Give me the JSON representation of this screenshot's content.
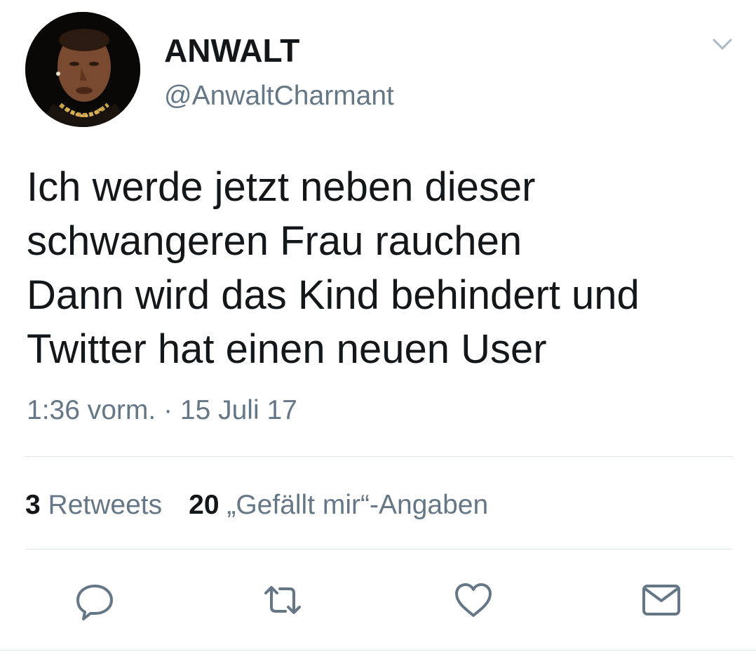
{
  "tweet": {
    "display_name": "ANWALT",
    "handle": "@AnwaltCharmant",
    "text": "Ich werde jetzt neben dieser\nschwangeren Frau rauchen\nDann wird das Kind behindert und\nTwitter hat einen neuen User",
    "timestamp": "1:36 vorm. · 15 Juli 17"
  },
  "stats": {
    "retweets_count": "3",
    "retweets_label": "Retweets",
    "likes_count": "20",
    "likes_label": "„Gefällt mir“-Angaben"
  },
  "icons": {
    "menu": "chevron-down-icon",
    "reply": "reply-icon",
    "retweet": "retweet-icon",
    "like": "heart-icon",
    "message": "envelope-icon"
  },
  "colors": {
    "text": "#14171a",
    "secondary": "#657786",
    "divider": "#e1e8ed",
    "icon": "#657786"
  }
}
